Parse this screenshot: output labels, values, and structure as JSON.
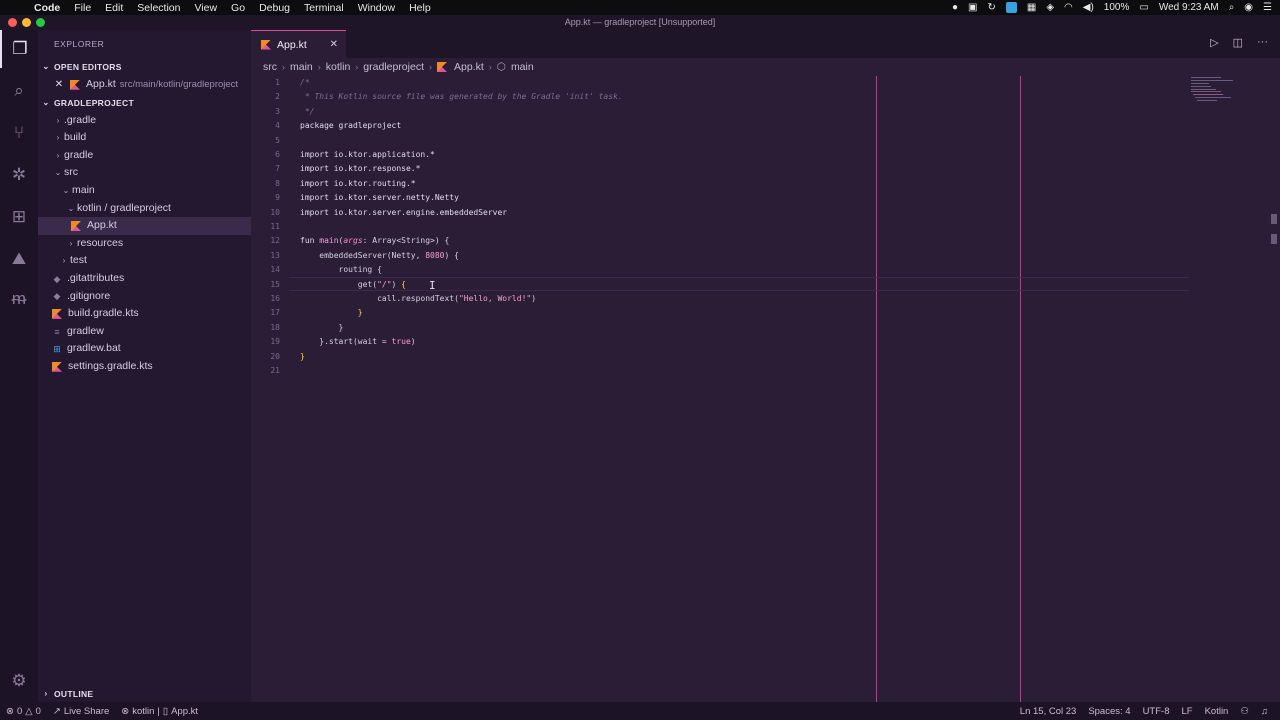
{
  "menubar": {
    "app": "Code",
    "items": [
      "File",
      "Edit",
      "Selection",
      "View",
      "Go",
      "Debug",
      "Terminal",
      "Window",
      "Help"
    ],
    "battery": "100%",
    "clock": "Wed 9:23 AM"
  },
  "window": {
    "title": "App.kt — gradleproject [Unsupported]"
  },
  "explorer": {
    "header": "EXPLORER",
    "open_editors": {
      "label": "OPEN EDITORS",
      "file": "App.kt",
      "path": "src/main/kotlin/gradleproject"
    },
    "project": {
      "label": "GRADLEPROJECT",
      "tree": [
        {
          "label": ".gradle",
          "type": "folder"
        },
        {
          "label": "build",
          "type": "folder"
        },
        {
          "label": "gradle",
          "type": "folder"
        },
        {
          "label": "src",
          "type": "folder-open"
        },
        {
          "label": "main",
          "type": "folder-open"
        },
        {
          "label": "kotlin / gradleproject",
          "type": "folder-open"
        },
        {
          "label": "App.kt",
          "type": "kotlin"
        },
        {
          "label": "resources",
          "type": "folder"
        },
        {
          "label": "test",
          "type": "folder"
        },
        {
          "label": ".gitattributes",
          "type": "file"
        },
        {
          "label": ".gitignore",
          "type": "file"
        },
        {
          "label": "build.gradle.kts",
          "type": "kotlin"
        },
        {
          "label": "gradlew",
          "type": "file"
        },
        {
          "label": "gradlew.bat",
          "type": "windows"
        },
        {
          "label": "settings.gradle.kts",
          "type": "kotlin"
        }
      ]
    },
    "outline": "OUTLINE"
  },
  "editor": {
    "tab": "App.kt",
    "breadcrumbs": [
      "src",
      "main",
      "kotlin",
      "gradleproject",
      "App.kt",
      "main"
    ],
    "line_numbers": [
      "1",
      "2",
      "3",
      "4",
      "5",
      "6",
      "7",
      "8",
      "9",
      "10",
      "11",
      "12",
      "13",
      "14",
      "15",
      "16",
      "17",
      "18",
      "19",
      "20",
      "21"
    ],
    "code": {
      "l1": "/*",
      "l2": " * This Kotlin source file was generated by the Gradle 'init' task.",
      "l3": " */",
      "l4": "package gradleproject",
      "l6": "import io.ktor.application.*",
      "l7": "import io.ktor.response.*",
      "l8": "import io.ktor.routing.*",
      "l9": "import io.ktor.server.netty.Netty",
      "l10": "import io.ktor.server.engine.embeddedServer",
      "l12_kw": "fun ",
      "l12_fn": "main",
      "l12_p1": "(",
      "l12_arg": "args",
      "l12_rest": ": Array<String>) {",
      "l13_a": "    embeddedServer(Netty, ",
      "l13_num": "8080",
      "l13_b": ") {",
      "l14": "        routing {",
      "l15_a": "            get(",
      "l15_str": "\"/\"",
      "l15_b": ") ",
      "l15_br": "{",
      "l16_a": "                call.respondText(",
      "l16_str": "\"Hello, World!\"",
      "l16_b": ")",
      "l17": "            }",
      "l18": "        }",
      "l19_a": "    }.start(wait = ",
      "l19_kw": "true",
      "l19_b": ")",
      "l20": "}"
    }
  },
  "status": {
    "errors": "0",
    "warnings": "0",
    "live_share": "Live Share",
    "kotlin_ctx": "kotlin",
    "file_ctx": "App.kt",
    "position": "Ln 15, Col 23",
    "spaces": "Spaces: 4",
    "encoding": "UTF-8",
    "eol": "LF",
    "language": "Kotlin"
  }
}
